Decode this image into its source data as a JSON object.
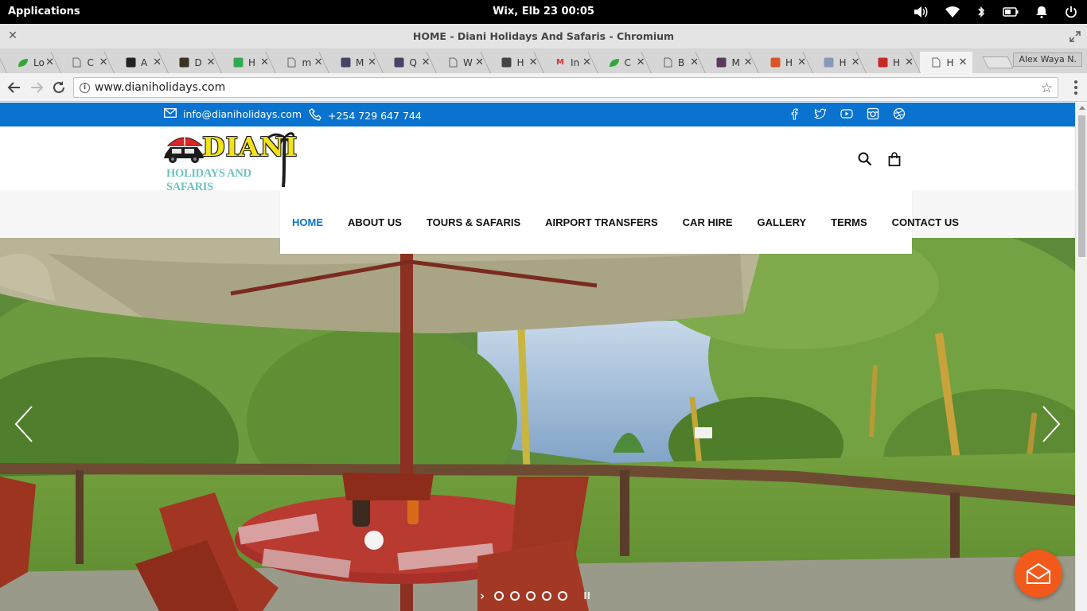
{
  "system_panel": {
    "applications_label": "Applications",
    "clock": "Wix, Elb 23    00:05"
  },
  "window": {
    "title": "HOME - Diani Holidays And Safaris - Chromium"
  },
  "tabs": [
    {
      "label": "Lo",
      "favicon": "leaf-icon",
      "color": "#33a63a"
    },
    {
      "label": "C",
      "favicon": "page-icon",
      "color": "#777777"
    },
    {
      "label": "A",
      "favicon": "square-icon",
      "color": "#222222"
    },
    {
      "label": "D",
      "favicon": "square-icon",
      "color": "#3a3420"
    },
    {
      "label": "H",
      "favicon": "map-icon",
      "color": "#34a853"
    },
    {
      "label": "m",
      "favicon": "page-icon",
      "color": "#777777"
    },
    {
      "label": "M",
      "favicon": "image-icon",
      "color": "#444466"
    },
    {
      "label": "Q",
      "favicon": "image-icon",
      "color": "#444466"
    },
    {
      "label": "W",
      "favicon": "page-icon",
      "color": "#777777"
    },
    {
      "label": "H",
      "favicon": "circle-icon",
      "color": "#444444"
    },
    {
      "label": "In",
      "favicon": "gmail-icon",
      "color": "#d93025"
    },
    {
      "label": "C",
      "favicon": "leaf-icon",
      "color": "#33a63a"
    },
    {
      "label": "B",
      "favicon": "page-icon",
      "color": "#777777"
    },
    {
      "label": "M",
      "favicon": "avatar-icon",
      "color": "#5a3a5a"
    },
    {
      "label": "H",
      "favicon": "badge-icon",
      "color": "#d8552a"
    },
    {
      "label": "H",
      "favicon": "cloud-icon",
      "color": "#8899bb"
    },
    {
      "label": "H",
      "favicon": "logo-icon",
      "color": "#c62828"
    },
    {
      "label": "H",
      "favicon": "page-icon",
      "color": "#777777"
    }
  ],
  "profile_name": "Alex Waya N.",
  "omnibox": {
    "url": "www.dianiholidays.com"
  },
  "site": {
    "contact": {
      "email": "info@dianiholidays.com",
      "phone": "+254 729 647 744"
    },
    "social_icons": [
      "facebook-icon",
      "twitter-icon",
      "youtube-icon",
      "instagram-icon",
      "dribbble-icon"
    ],
    "logo": {
      "word": "DIANI",
      "subtitle": "HOLIDAYS AND SAFARIS"
    },
    "nav": [
      {
        "label": "HOME",
        "active": true
      },
      {
        "label": "ABOUT US",
        "active": false
      },
      {
        "label": "TOURS & SAFARIS",
        "active": false
      },
      {
        "label": "AIRPORT TRANSFERS",
        "active": false
      },
      {
        "label": "CAR HIRE",
        "active": false
      },
      {
        "label": "GALLERY",
        "active": false
      },
      {
        "label": "TERMS",
        "active": false
      },
      {
        "label": "CONTACT US",
        "active": false
      }
    ],
    "slider": {
      "slide_count": 5,
      "pause_symbol": "II"
    }
  },
  "colors": {
    "brand_blue": "#0a73cf",
    "chat_orange": "#f15a1a"
  }
}
